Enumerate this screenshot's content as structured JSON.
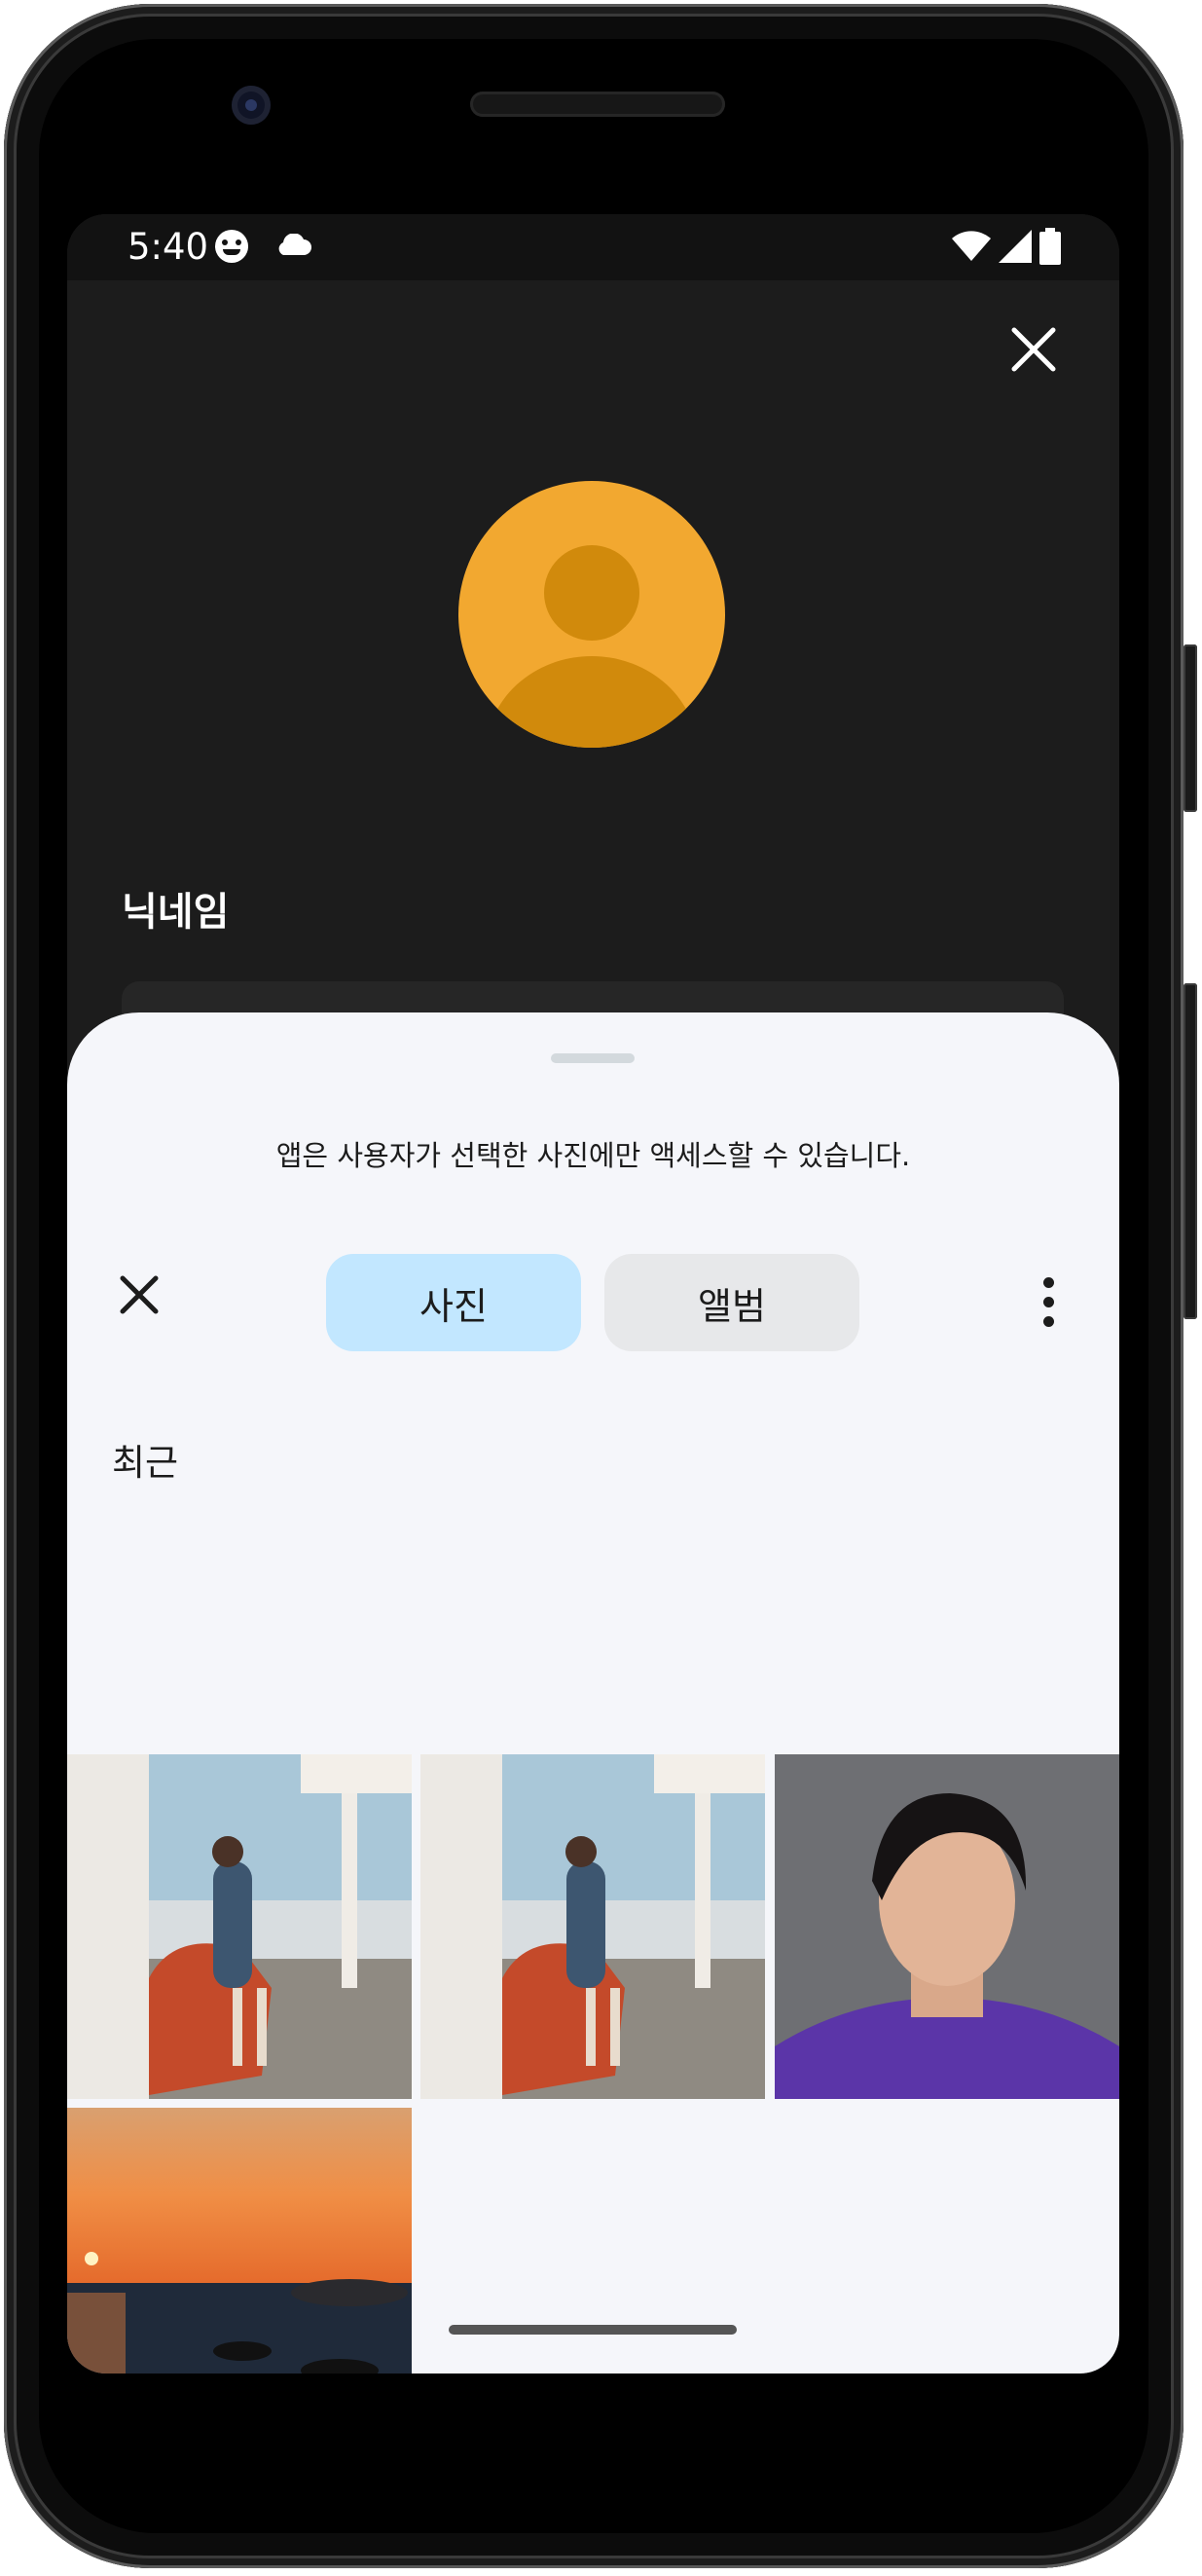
{
  "status_bar": {
    "time": "5:40"
  },
  "profile": {
    "nickname_label": "닉네임"
  },
  "picker": {
    "notice": "앱은 사용자가 선택한 사진에만 액세스할 수 있습니다.",
    "tabs": [
      {
        "label": "사진",
        "selected": true
      },
      {
        "label": "앨범",
        "selected": false
      }
    ],
    "section_title": "최근",
    "photos": [
      {
        "name": "photo-woman-red-car-1"
      },
      {
        "name": "photo-woman-red-car-2"
      },
      {
        "name": "photo-man-portrait"
      },
      {
        "name": "photo-sunset-sea"
      }
    ]
  },
  "colors": {
    "accent_tab": "#c2e7ff",
    "avatar_bg": "#f2a830",
    "sheet_bg": "#f5f6fa"
  },
  "icons": [
    "close-icon",
    "more-vert-icon",
    "wifi-icon",
    "signal-icon",
    "battery-icon",
    "cloud-icon"
  ]
}
